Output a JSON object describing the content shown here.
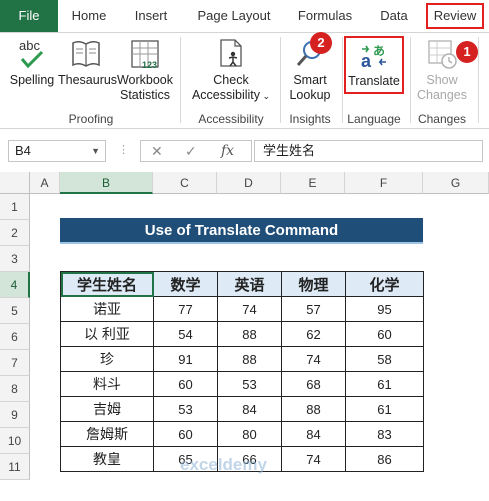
{
  "ribbon": {
    "tabs": [
      "File",
      "Home",
      "Insert",
      "Page Layout",
      "Formulas",
      "Data",
      "Review"
    ],
    "groups": {
      "proofing": "Proofing",
      "accessibility": "Accessibility",
      "insights": "Insights",
      "language": "Language",
      "changes": "Changes"
    },
    "buttons": {
      "spelling": "Spelling",
      "thesaurus": "Thesaurus",
      "workbook_stats_1": "Workbook",
      "workbook_stats_2": "Statistics",
      "check_acc_1": "Check",
      "check_acc_2": "Accessibility",
      "smart_1": "Smart",
      "smart_2": "Lookup",
      "translate": "Translate",
      "show_1": "Show",
      "show_2": "Changes"
    },
    "badges": {
      "review": "1",
      "translate": "2"
    },
    "accent": "#217346",
    "highlight": "#e32020"
  },
  "formula_bar": {
    "name_box": "B4",
    "content": "学生姓名"
  },
  "grid": {
    "columns": [
      "A",
      "B",
      "C",
      "D",
      "E",
      "F",
      "G"
    ],
    "rows": [
      "1",
      "2",
      "3",
      "4",
      "5",
      "6",
      "7",
      "8",
      "9",
      "10",
      "11"
    ],
    "title": "Use of Translate Command",
    "table_header": [
      "学生姓名",
      "数学",
      "英语",
      "物理",
      "化学"
    ],
    "table_rows": [
      [
        "诺亚",
        "77",
        "74",
        "57",
        "95"
      ],
      [
        "以 利亚",
        "54",
        "88",
        "62",
        "60"
      ],
      [
        "珍",
        "91",
        "88",
        "74",
        "58"
      ],
      [
        "料斗",
        "60",
        "53",
        "68",
        "61"
      ],
      [
        "吉姆",
        "53",
        "84",
        "88",
        "61"
      ],
      [
        "詹姆斯",
        "60",
        "80",
        "84",
        "83"
      ],
      [
        "教皇",
        "65",
        "66",
        "74",
        "86"
      ]
    ],
    "header_fill": "#deebf7",
    "title_fill": "#1f4e79"
  },
  "watermark": "exceldemy"
}
